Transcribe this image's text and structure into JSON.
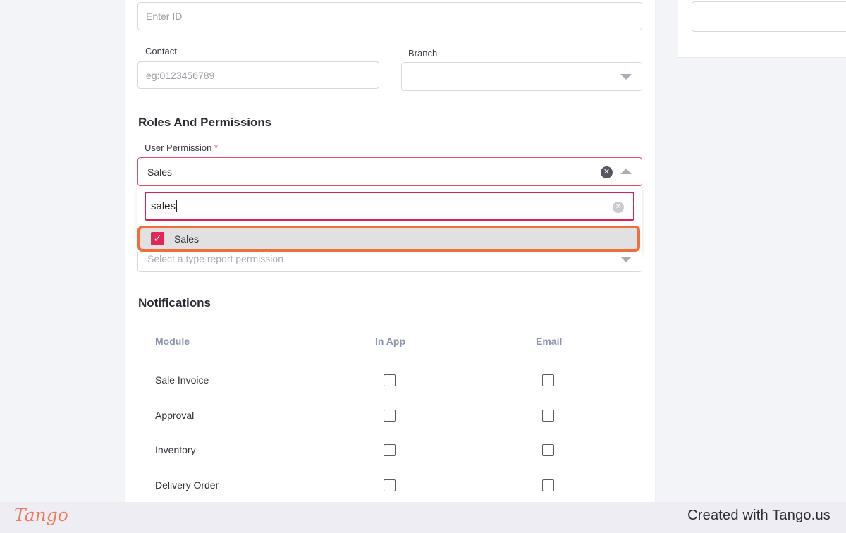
{
  "form": {
    "id_placeholder": "Enter ID",
    "contact_label": "Contact",
    "contact_placeholder": "eg:0123456789",
    "branch_label": "Branch",
    "branch_value": ""
  },
  "roles": {
    "heading": "Roles And Permissions",
    "user_permission_label": "User Permission",
    "required_mark": "*",
    "user_permission_value": "Sales",
    "search_value": "sales",
    "options": [
      {
        "label": "Sales",
        "checked": true
      }
    ],
    "report_placeholder": "Select a type report permission"
  },
  "notifications": {
    "heading": "Notifications",
    "columns": [
      "Module",
      "In App",
      "Email"
    ],
    "rows": [
      {
        "module": "Sale Invoice",
        "in_app": false,
        "email": false
      },
      {
        "module": "Approval",
        "in_app": false,
        "email": false
      },
      {
        "module": "Inventory",
        "in_app": false,
        "email": false
      },
      {
        "module": "Delivery Order",
        "in_app": false,
        "email": false
      }
    ]
  },
  "footer": {
    "logo": "Tango",
    "credit": "Created with Tango.us"
  },
  "colors": {
    "accent": "#e2265a",
    "highlight": "#f26d3a",
    "header_text": "#8b94ad"
  },
  "icons": {
    "checkbox_checked": "check-icon",
    "clear": "clear-icon",
    "dropdown": "chevron-down-icon",
    "collapse": "chevron-up-icon"
  }
}
